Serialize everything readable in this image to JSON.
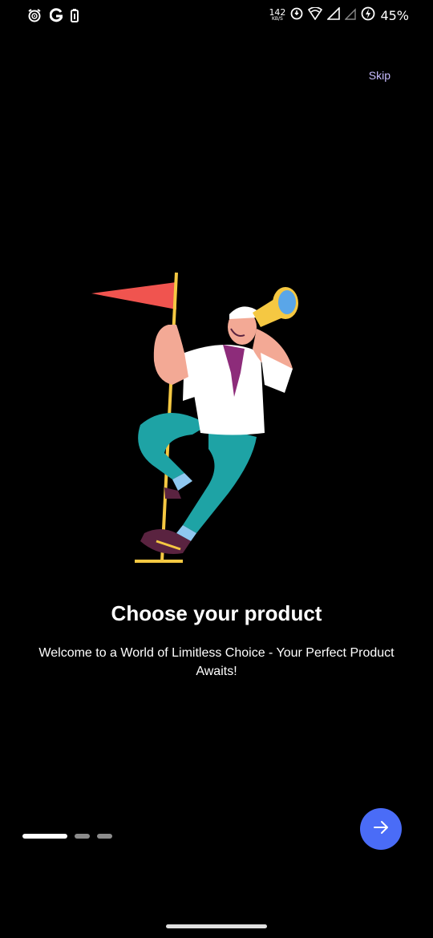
{
  "status_bar": {
    "net_speed_value": "142",
    "net_speed_unit": "KB/S",
    "battery_percent": "45%",
    "icons": [
      "alarm-icon",
      "google-icon",
      "battery-saver-icon",
      "data-saver-icon",
      "wifi-icon",
      "signal-icon",
      "signal-icon-2",
      "battery-icon"
    ]
  },
  "skip_label": "Skip",
  "onboarding": {
    "title": "Choose your product",
    "subtitle": "Welcome to a World of Limitless Choice - Your Perfect Product Awaits!",
    "illustration": "sailor-with-flag-and-telescope",
    "page_count": 3,
    "current_page": 1
  },
  "next_button": {
    "icon": "arrow-right-icon"
  },
  "colors": {
    "background": "#000000",
    "accent": "#4a6cf7",
    "skip": "#c8bcff"
  }
}
